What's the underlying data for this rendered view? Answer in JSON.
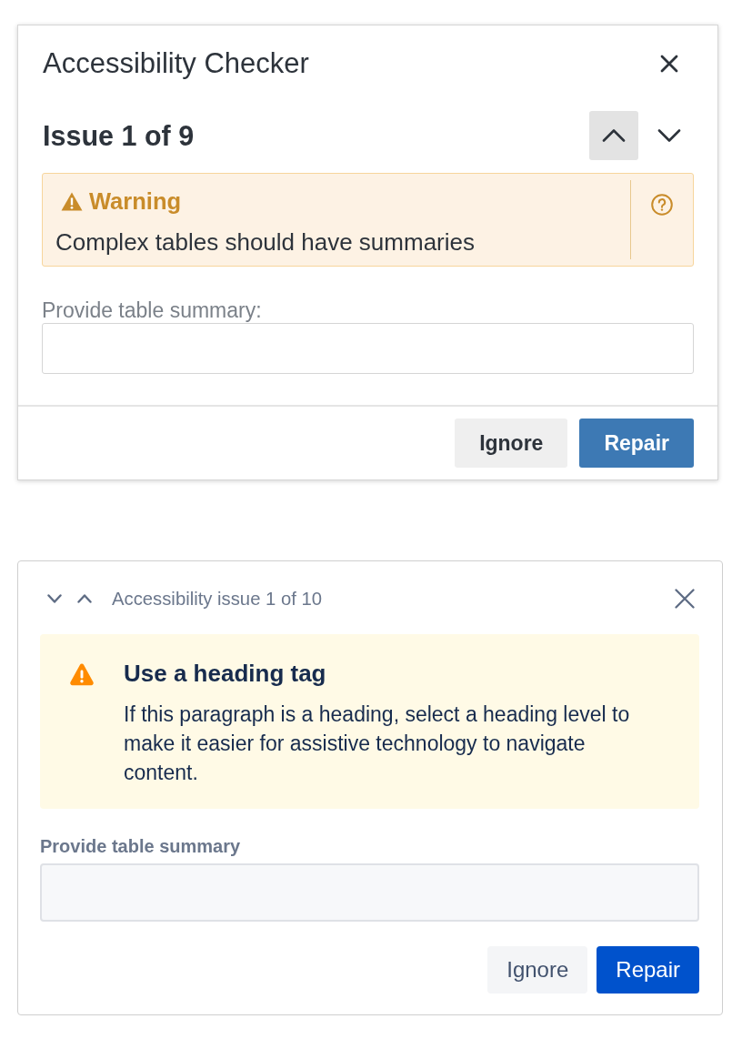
{
  "panels": [
    {
      "kind": "classic",
      "title": "Accessibility Checker",
      "issue_counter": "Issue 1 of 9",
      "nav_buttons": [
        {
          "kind": "up",
          "selected": true
        },
        {
          "kind": "down",
          "selected": false
        }
      ],
      "issue": {
        "severity": "Warning",
        "message": "Complex tables should have summaries"
      },
      "field": {
        "label": "Provide table summary:"
      },
      "buttons": [
        {
          "label": "Ignore",
          "kind": "secondary"
        },
        {
          "label": "Repair",
          "kind": "primary"
        }
      ]
    },
    {
      "kind": "inline",
      "nav_buttons": [
        {
          "kind": "down"
        },
        {
          "kind": "up"
        }
      ],
      "issue_counter": "Accessibility issue 1 of 10",
      "issue": {
        "title": "Use a heading tag",
        "message": "If this paragraph is a heading, select a heading level to make it easier for assistive technology to navigate content."
      },
      "field": {
        "label": "Provide table summary"
      },
      "buttons": [
        {
          "label": "Ignore",
          "kind": "secondary"
        },
        {
          "label": "Repair",
          "kind": "primary"
        }
      ]
    }
  ]
}
